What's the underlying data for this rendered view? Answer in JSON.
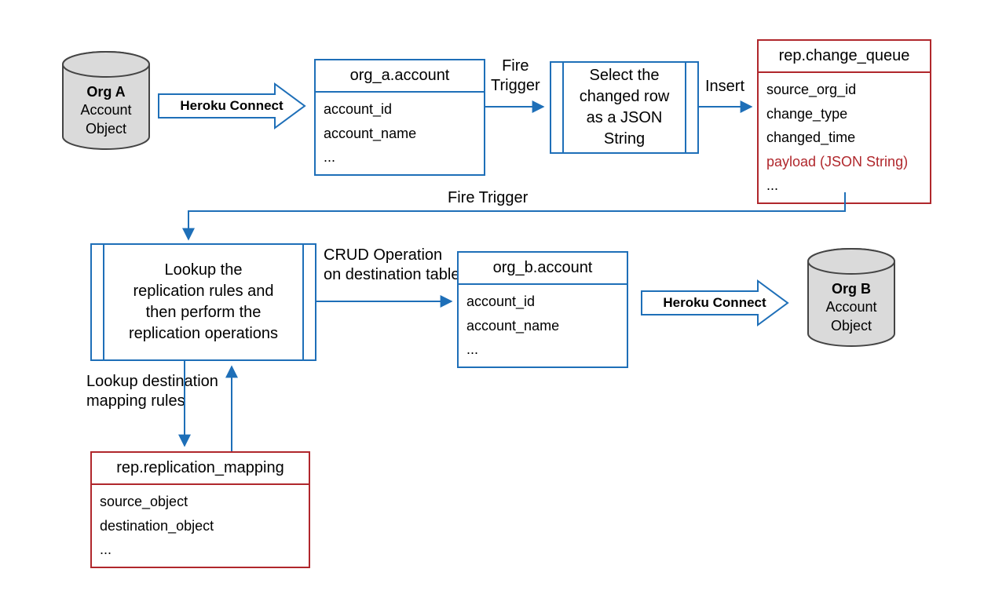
{
  "dbA": {
    "title": "Org A",
    "subtitle1": "Account",
    "subtitle2": "Object"
  },
  "dbB": {
    "title": "Org B",
    "subtitle1": "Account",
    "subtitle2": "Object"
  },
  "heroku1": "Heroku Connect",
  "heroku2": "Heroku Connect",
  "tableA": {
    "name": "org_a.account",
    "rows": [
      "account_id",
      "account_name",
      "..."
    ]
  },
  "tableB": {
    "name": "org_b.account",
    "rows": [
      "account_id",
      "account_name",
      "..."
    ]
  },
  "changeQueue": {
    "name": "rep.change_queue",
    "rows": [
      "source_org_id",
      "change_type",
      "changed_time",
      "payload (JSON String)",
      "..."
    ]
  },
  "repMapping": {
    "name": "rep.replication_mapping",
    "rows": [
      "source_object",
      "destination_object",
      "..."
    ]
  },
  "procSelect": "Select the\nchanged row\nas a JSON\nString",
  "procLookup": "Lookup the\nreplication rules and\nthen perform the\nreplication operations",
  "labels": {
    "fireTrigger1": "Fire\nTrigger",
    "insert": "Insert",
    "fireTrigger2": "Fire Trigger",
    "crud": "CRUD Operation\non destination table",
    "lookupRules": "Lookup destination\nmapping rules"
  },
  "colors": {
    "blue": "#1e6fb8",
    "red": "#b0272c",
    "grey": "#dadada"
  }
}
